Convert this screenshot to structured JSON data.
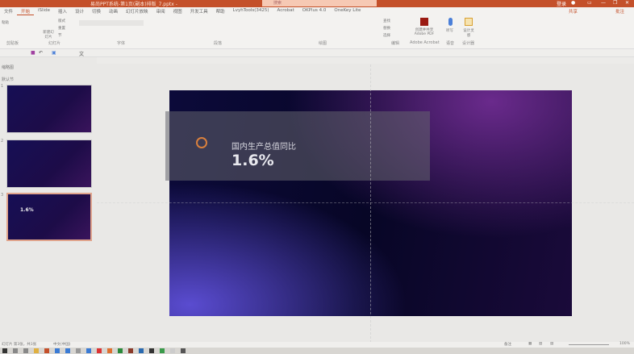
{
  "window": {
    "title": "易尚PPT系统-第1页(副本)排版_7.pptx -",
    "search_placeholder": "搜索",
    "user": "登录"
  },
  "tabs": [
    "文件",
    "开始",
    "iSlide",
    "插入",
    "设计",
    "切换",
    "动画",
    "幻灯片放映",
    "审阅",
    "视图",
    "开发工具",
    "帮助",
    "LvyhTools(3425)",
    "Acrobat",
    "OKPlus 4.0",
    "OneKey Lite"
  ],
  "active_tab": "开始",
  "tabs_right": {
    "share": "共享",
    "comment": "批注"
  },
  "ribbon": {
    "groups": [
      "剪贴板",
      "幻灯片",
      "字体",
      "段落",
      "绘图",
      "编辑",
      "Adobe Acrobat",
      "语音",
      "设计器"
    ],
    "buttons": {
      "paste": "粘贴",
      "new_slide": "新建幻灯片",
      "layout": "版式",
      "reset": "重置",
      "section": "节",
      "find": "查找",
      "replace": "替换",
      "select": "选择",
      "create_pdf": "创建并共享 Adobe PDF",
      "dictate": "听写",
      "design_ideas": "设计灵感"
    }
  },
  "panels": {
    "outline": "缩略图",
    "sections": "默认节"
  },
  "thumbnails": [
    {
      "num": "1"
    },
    {
      "num": "2"
    },
    {
      "num": "3",
      "selected": true
    }
  ],
  "slide": {
    "label": "国内生产总值同比",
    "value": "1.6%"
  },
  "status": {
    "slide_info": "幻灯片 第3张，共3张",
    "lang": "中文(中国)",
    "notes": "备注",
    "zoom": "100%"
  },
  "colors": {
    "accent": "#c4502a",
    "slide_bg": "#0c0a3a"
  }
}
